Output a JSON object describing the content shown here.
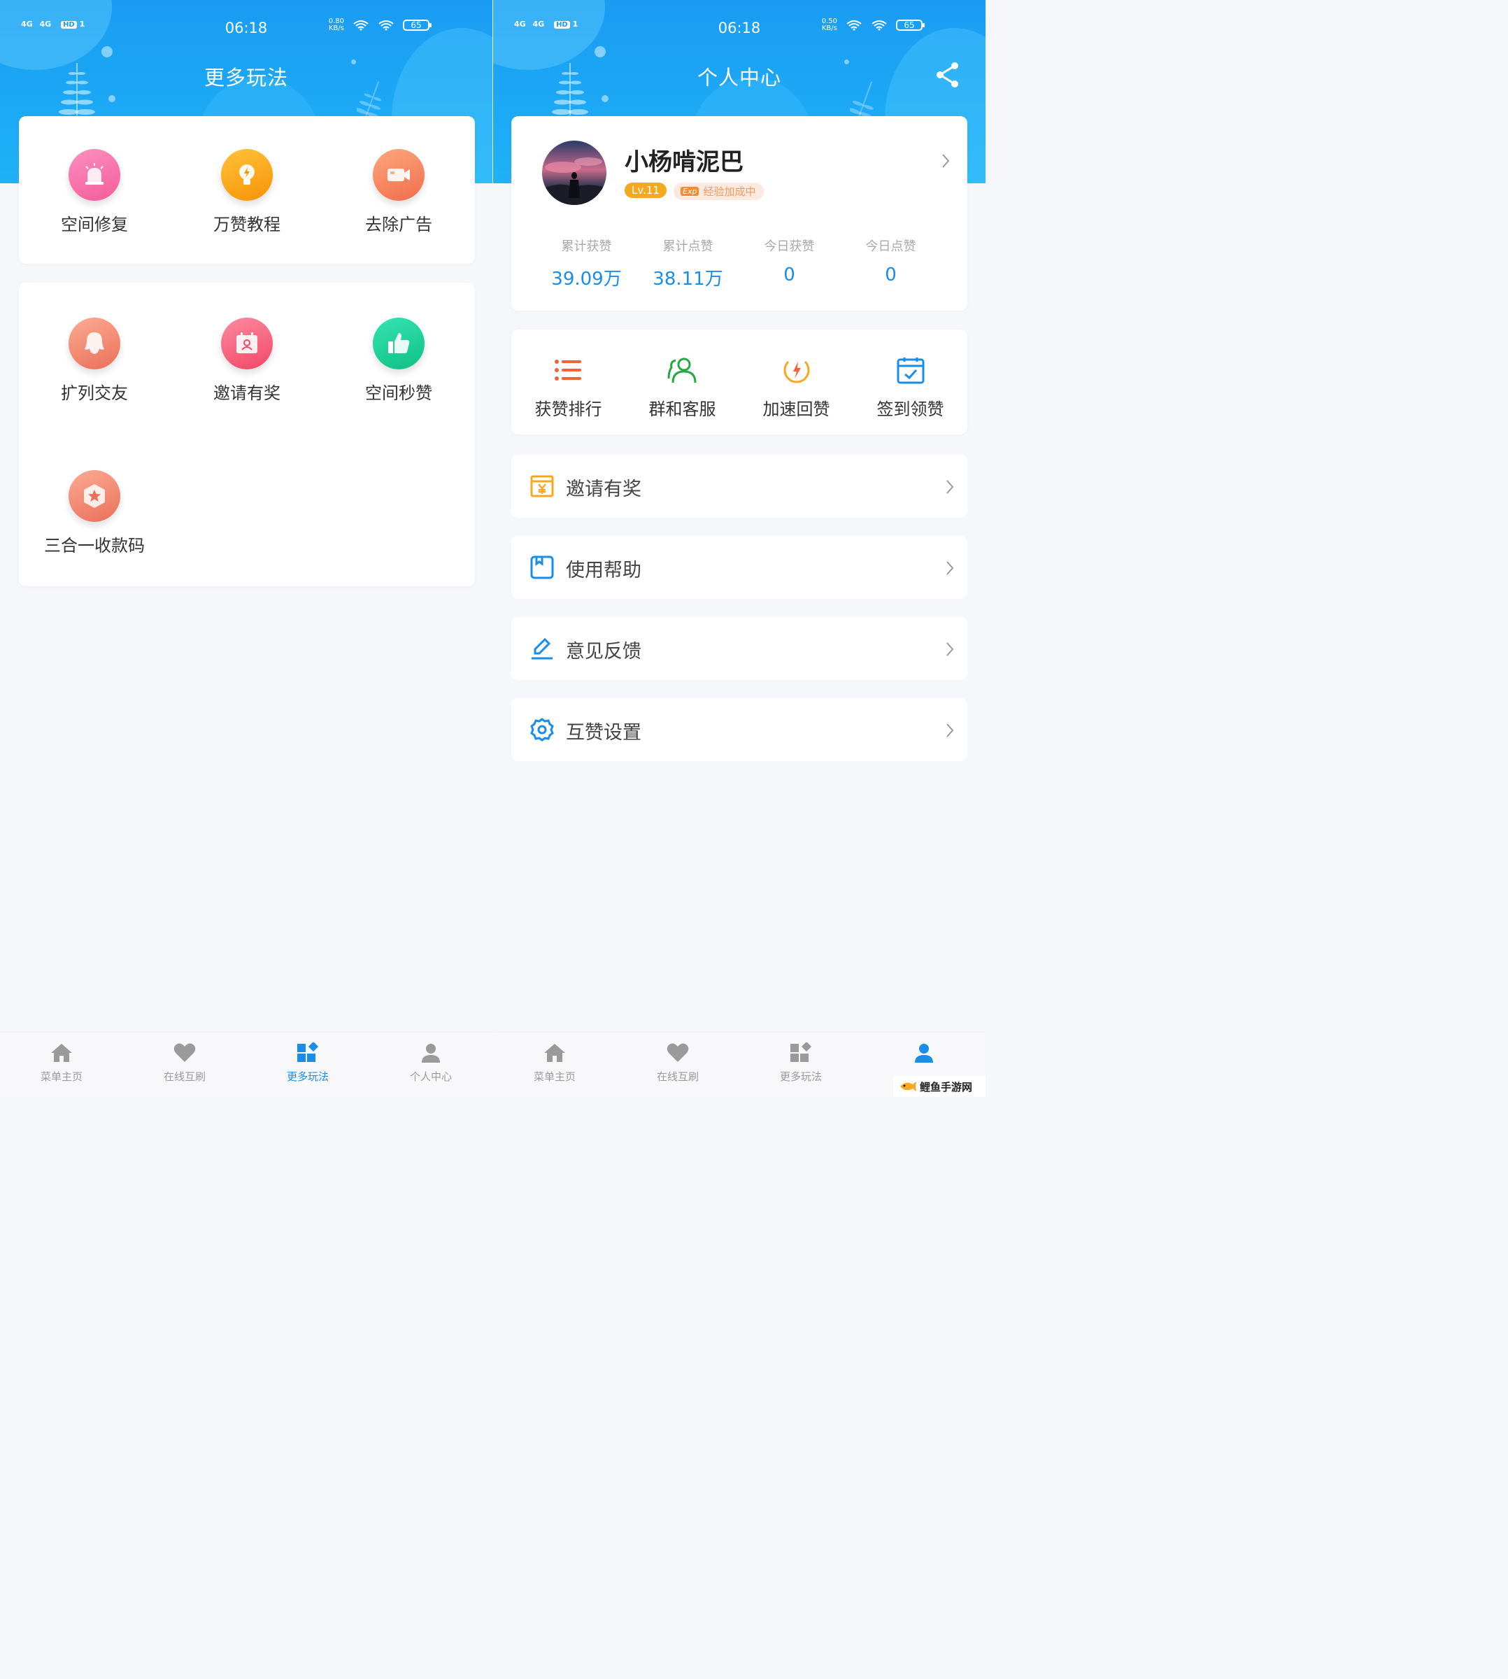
{
  "status": {
    "signal_left": "4G",
    "signal_right": "4G",
    "hd": "HD",
    "sim": "1",
    "battery": "65",
    "left_screen": {
      "time": "06:18",
      "speed_top": "0.80",
      "speed_unit": "KB/s"
    },
    "right_screen": {
      "time": "06:18",
      "speed_top": "0.50",
      "speed_unit": "KB/s"
    }
  },
  "left": {
    "title": "更多玩法",
    "card1": [
      {
        "label": "空间修复",
        "icon": "alarm-icon",
        "color": "#f66fa8"
      },
      {
        "label": "万赞教程",
        "icon": "bulb-icon",
        "color": "#f8a416"
      },
      {
        "label": "去除广告",
        "icon": "video-icon",
        "color": "#f5865c"
      }
    ],
    "card2": [
      {
        "label": "扩列交友",
        "icon": "qq-penguin-icon",
        "color": "#f08a72"
      },
      {
        "label": "邀请有奖",
        "icon": "invite-card-icon",
        "color": "#f5627a"
      },
      {
        "label": "空间秒赞",
        "icon": "thumbs-up-icon",
        "color": "#1fcf9a"
      },
      {
        "label": "三合一收款码",
        "icon": "star-badge-icon",
        "color": "#f08f72"
      }
    ]
  },
  "right": {
    "title": "个人中心",
    "profile": {
      "name": "小杨啃泥巴",
      "level": "Lv.11",
      "exp_tag": "Exp",
      "exp_text": "经验加成中"
    },
    "stats": [
      {
        "label": "累计获赞",
        "value": "39.09万"
      },
      {
        "label": "累计点赞",
        "value": "38.11万"
      },
      {
        "label": "今日获赞",
        "value": "0"
      },
      {
        "label": "今日点赞",
        "value": "0"
      }
    ],
    "quick": [
      {
        "label": "获赞排行",
        "icon": "list-icon",
        "color": "#f4623a"
      },
      {
        "label": "群和客服",
        "icon": "group-icon",
        "color": "#28a745"
      },
      {
        "label": "加速回赞",
        "icon": "speed-icon",
        "color": "#f6a821"
      },
      {
        "label": "签到领赞",
        "icon": "calendar-check-icon",
        "color": "#1a8de9"
      }
    ],
    "rows": [
      {
        "label": "邀请有奖",
        "icon": "invite-yuan-icon",
        "color": "#f6a821"
      },
      {
        "label": "使用帮助",
        "icon": "help-book-icon",
        "color": "#1a8de9"
      },
      {
        "label": "意见反馈",
        "icon": "pen-icon",
        "color": "#1a8de9"
      },
      {
        "label": "互赞设置",
        "icon": "gear-icon",
        "color": "#1a8de9"
      }
    ]
  },
  "tabs": [
    {
      "label": "菜单主页",
      "icon": "home-icon"
    },
    {
      "label": "在线互刷",
      "icon": "heart-icon"
    },
    {
      "label": "更多玩法",
      "icon": "apps-icon"
    },
    {
      "label": "个人中心",
      "icon": "user-icon"
    }
  ],
  "accent": "#1a8de9",
  "watermark": "鲤鱼手游网"
}
